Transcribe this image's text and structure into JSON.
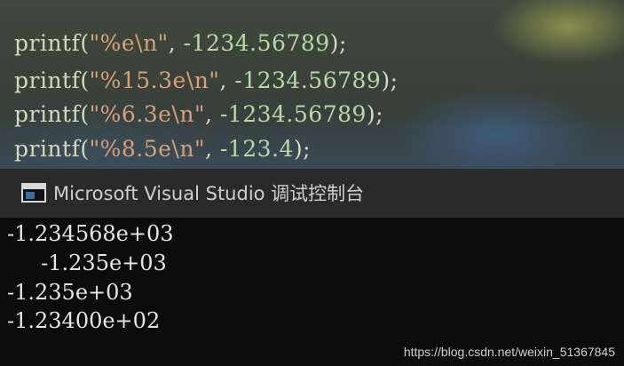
{
  "code": {
    "lines": [
      {
        "fn": "printf(",
        "str": "\"%e\\n\"",
        "mid": ", ",
        "num": "-1234.56789",
        "end": ");"
      },
      {
        "fn": "printf(",
        "str": "\"%15.3e\\n\"",
        "mid": ", ",
        "num": "-1234.56789",
        "end": ");"
      },
      {
        "fn": "printf(",
        "str": "\"%6.3e\\n\"",
        "mid": ", ",
        "num": "-1234.56789",
        "end": ");"
      },
      {
        "fn": "printf(",
        "str": "\"%8.5e\\n\"",
        "mid": ", ",
        "num": "-123.4",
        "end": ");"
      }
    ]
  },
  "console": {
    "title": "Microsoft Visual Studio 调试控制台",
    "output": [
      "-1.234568e+03",
      "     -1.235e+03",
      "-1.235e+03",
      "-1.23400e+02"
    ]
  },
  "watermark": "https://blog.csdn.net/weixin_51367845"
}
